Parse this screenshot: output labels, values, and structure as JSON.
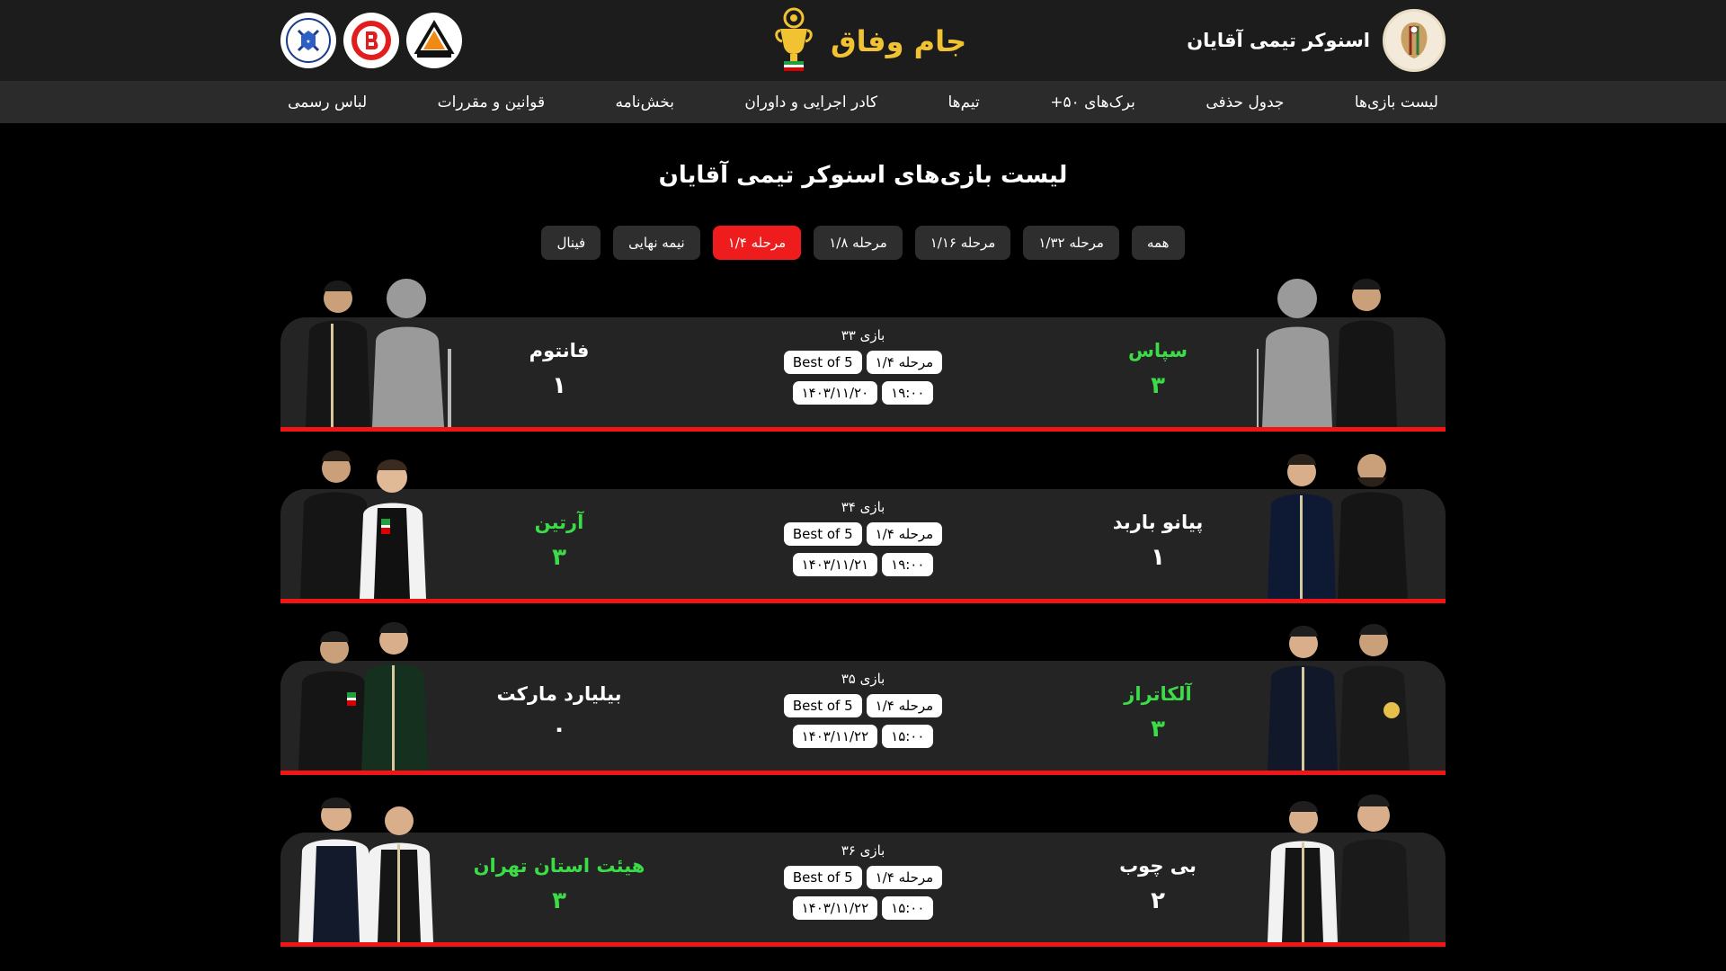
{
  "header": {
    "site_title": "اسنوکر تیمی آقایان",
    "cup_title": "جام وفاق",
    "partner_logos": [
      "federation-seal-logo",
      "red-b-logo",
      "triangle-club-logo"
    ]
  },
  "nav": [
    "لیست بازی‌ها",
    "جدول حذفی",
    "برک‌های ۵۰+",
    "تیم‌ها",
    "کادر اجرایی و داوران",
    "بخش‌نامه",
    "قوانین و مقررات",
    "لباس رسمی"
  ],
  "page_title": "لیست بازی‌های اسنوکر تیمی آقایان",
  "filters": {
    "items": [
      "همه",
      "مرحله ۱/۳۲",
      "مرحله ۱/۱۶",
      "مرحله ۱/۸",
      "مرحله ۱/۴",
      "نیمه نهایی",
      "فینال"
    ],
    "active": "مرحله ۱/۴"
  },
  "colors": {
    "accent_red": "#ee1c1c",
    "winner_green": "#3cdc48",
    "cup_gold": "#f1c232",
    "card_bg": "#242424"
  },
  "matches": [
    {
      "game": "بازی ۳۳",
      "stage": "مرحله ۱/۴",
      "format": "Best of 5",
      "time": "۱۹:۰۰",
      "date": "۱۴۰۳/۱۱/۲۰",
      "home": {
        "name": "سپاس",
        "score": "۳",
        "winner": true
      },
      "away": {
        "name": "فانتوم",
        "score": "۱",
        "winner": false
      }
    },
    {
      "game": "بازی ۳۴",
      "stage": "مرحله ۱/۴",
      "format": "Best of 5",
      "time": "۱۹:۰۰",
      "date": "۱۴۰۳/۱۱/۲۱",
      "home": {
        "name": "پیانو باربد",
        "score": "۱",
        "winner": false
      },
      "away": {
        "name": "آرتین",
        "score": "۳",
        "winner": true
      }
    },
    {
      "game": "بازی ۳۵",
      "stage": "مرحله ۱/۴",
      "format": "Best of 5",
      "time": "۱۵:۰۰",
      "date": "۱۴۰۳/۱۱/۲۲",
      "home": {
        "name": "آلکاتراز",
        "score": "۳",
        "winner": true
      },
      "away": {
        "name": "بیلیارد مارکت",
        "score": "۰",
        "winner": false
      }
    },
    {
      "game": "بازی ۳۶",
      "stage": "مرحله ۱/۴",
      "format": "Best of 5",
      "time": "۱۵:۰۰",
      "date": "۱۴۰۳/۱۱/۲۲",
      "home": {
        "name": "بی چوب",
        "score": "۲",
        "winner": false
      },
      "away": {
        "name": "هیئت استان تهران",
        "score": "۳",
        "winner": true
      }
    }
  ]
}
